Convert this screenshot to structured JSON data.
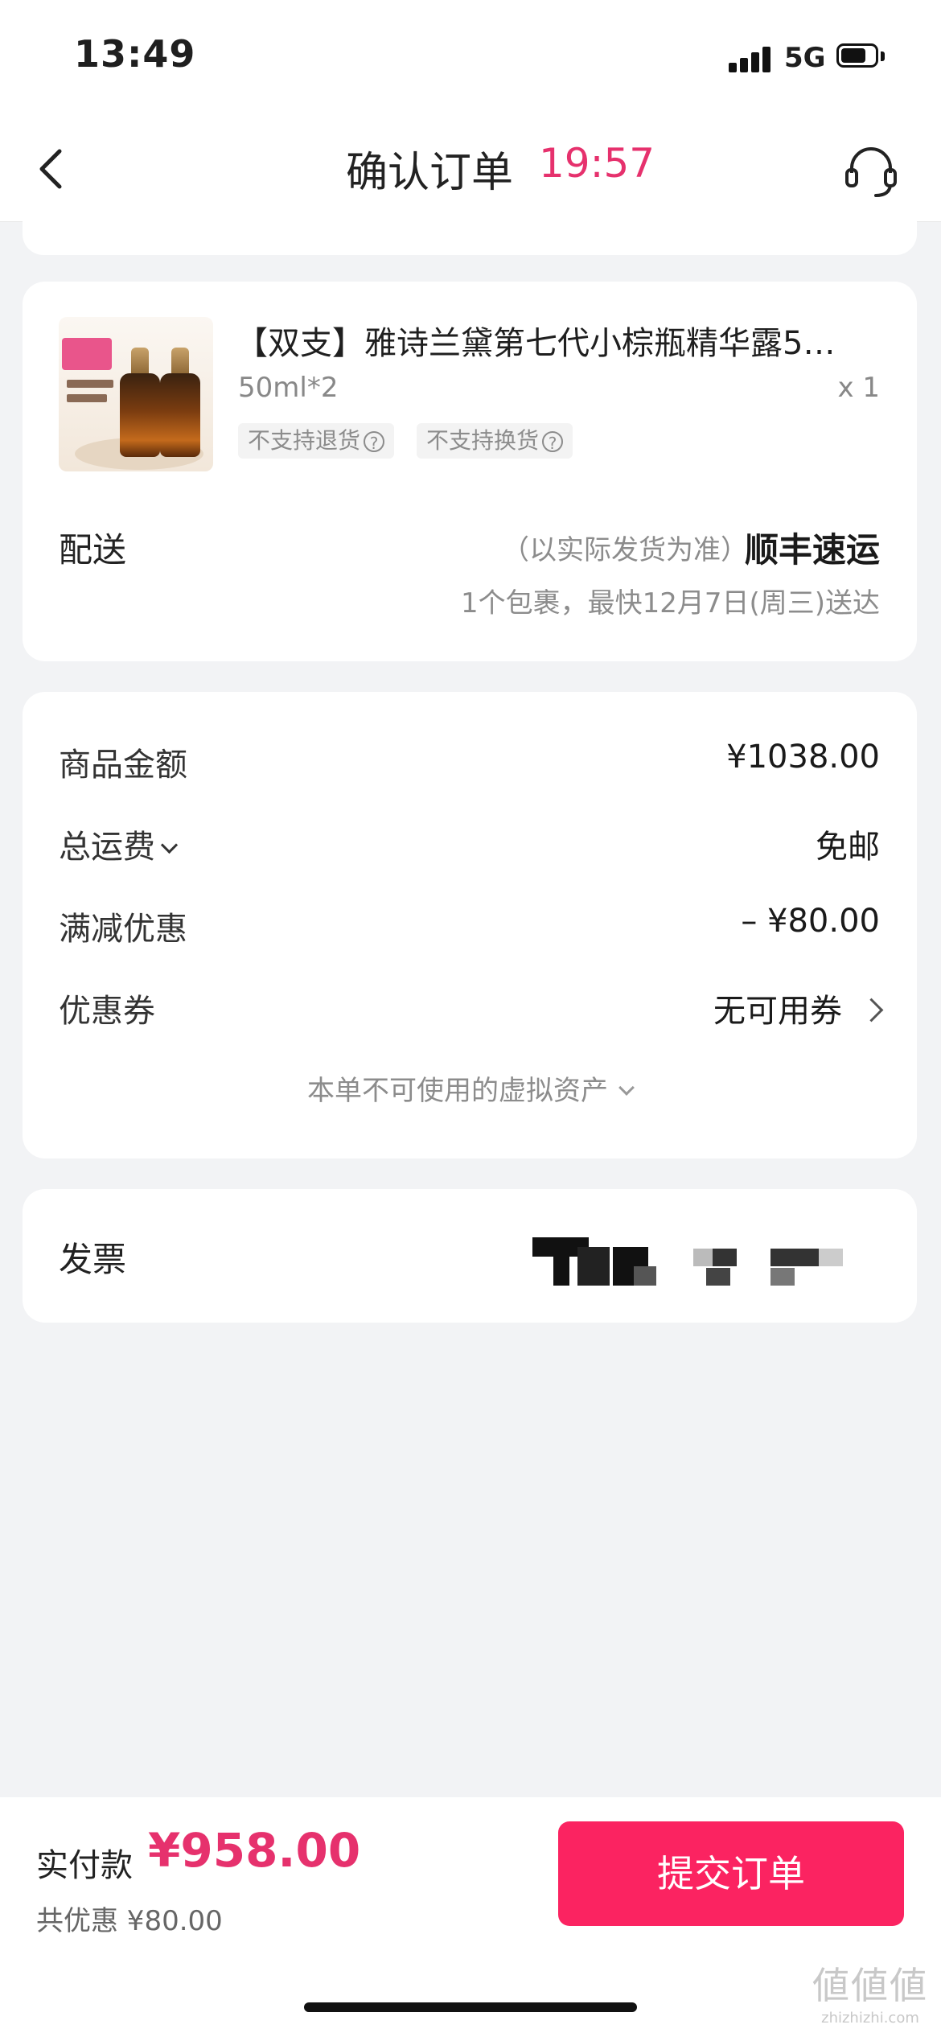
{
  "status_bar": {
    "time": "13:49",
    "network": "5G"
  },
  "nav": {
    "title": "确认订单",
    "timer": "19:57"
  },
  "product": {
    "title": "【双支】雅诗兰黛第七代小棕瓶精华露5…",
    "spec": "50ml*2",
    "quantity": "x 1",
    "badges": [
      "不支持退货",
      "不支持换货"
    ],
    "help_glyph": "?"
  },
  "shipping": {
    "label": "配送",
    "note": "（以实际发货为准）",
    "carrier": "顺丰速运",
    "eta": "1个包裹，最快12月7日(周三)送达"
  },
  "pricing": {
    "rows": [
      {
        "label": "商品金额",
        "value": "¥1038.00"
      },
      {
        "label": "总运费",
        "value": "免邮"
      },
      {
        "label": "满减优惠",
        "value": "– ¥80.00"
      },
      {
        "label": "优惠券",
        "value": "无可用券"
      }
    ],
    "virtual_assets": "本单不可使用的虚拟资产"
  },
  "invoice": {
    "label": "发票"
  },
  "footer": {
    "pay_label": "实付款",
    "pay_amount": "¥958.00",
    "saved": "共优惠 ¥80.00",
    "submit": "提交订单"
  },
  "watermark": {
    "glyphs": "値値値",
    "domain": "zhizhizhi.com"
  },
  "colors": {
    "accent": "#e6316d",
    "button": "#fb2361",
    "background": "#f2f3f5"
  }
}
